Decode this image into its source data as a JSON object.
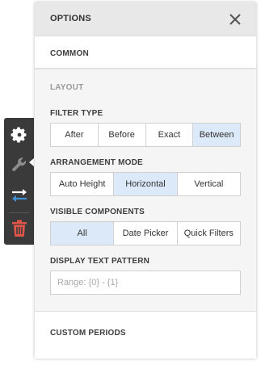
{
  "panel": {
    "title": "OPTIONS",
    "close_icon": "close-icon"
  },
  "sections": {
    "common": "COMMON",
    "layout": "LAYOUT",
    "custom_periods": "CUSTOM PERIODS"
  },
  "filter_type": {
    "label": "FILTER TYPE",
    "options": [
      "After",
      "Before",
      "Exact",
      "Between"
    ],
    "selected": "Between"
  },
  "arrangement_mode": {
    "label": "ARRANGEMENT MODE",
    "options": [
      "Auto Height",
      "Horizontal",
      "Vertical"
    ],
    "selected": "Horizontal"
  },
  "visible_components": {
    "label": "VISIBLE COMPONENTS",
    "options": [
      "All",
      "Date Picker",
      "Quick Filters"
    ],
    "selected": "All"
  },
  "display_text_pattern": {
    "label": "DISPLAY TEXT PATTERN",
    "value": "",
    "placeholder": "Range: {0} - {1}"
  },
  "toolbar": {
    "icons": [
      "gear-icon",
      "wrench-icon",
      "swap-arrows-icon",
      "trash-icon"
    ]
  },
  "colors": {
    "selected_bg": "#dce9f8",
    "toolbar_bg": "#3a3a3a",
    "arrows": "#3d8fd6",
    "trash": "#e0574a"
  }
}
